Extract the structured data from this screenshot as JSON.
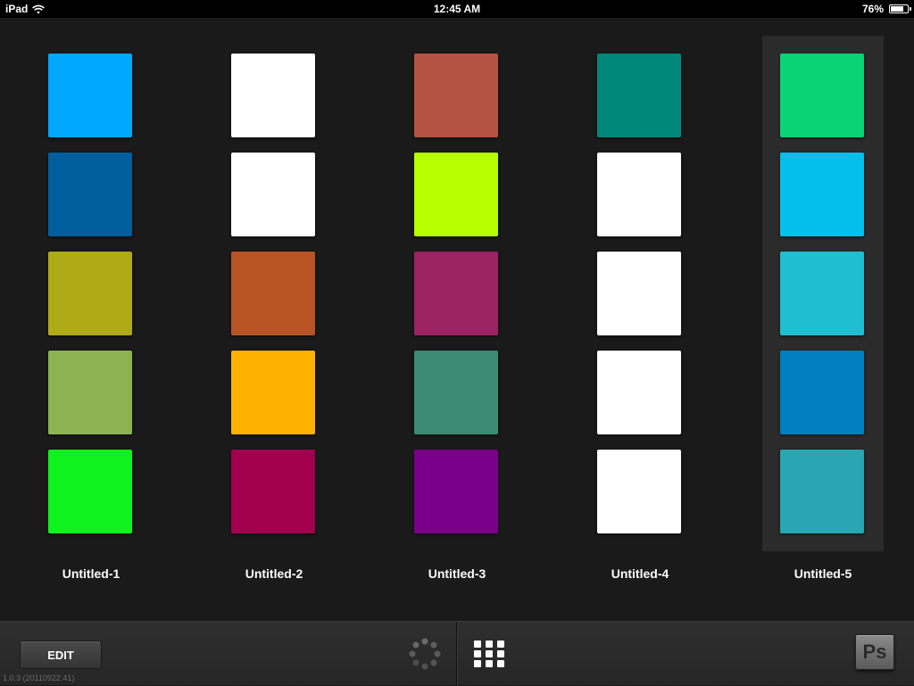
{
  "status_bar": {
    "device": "iPad",
    "time": "12:45 AM",
    "battery": "76%",
    "battery_level": 0.76
  },
  "documents": [
    {
      "label": "Untitled-1",
      "selected": false,
      "swatches": [
        "#00a8ff",
        "#005f9c",
        "#afaa18",
        "#8db353",
        "#0ff21e"
      ]
    },
    {
      "label": "Untitled-2",
      "selected": false,
      "swatches": [
        "#ffffff",
        "#ffffff",
        "#b85325",
        "#ffb100",
        "#a2004f"
      ]
    },
    {
      "label": "Untitled-3",
      "selected": false,
      "swatches": [
        "#b55244",
        "#b4ff00",
        "#9b2263",
        "#3c8c74",
        "#7a008a"
      ]
    },
    {
      "label": "Untitled-4",
      "selected": false,
      "swatches": [
        "#01877a",
        "#ffffff",
        "#ffffff",
        "#ffffff",
        "#ffffff"
      ]
    },
    {
      "label": "Untitled-5",
      "selected": true,
      "swatches": [
        "#0bd274",
        "#04bfe9",
        "#1fbed1",
        "#007fc1",
        "#28a6b2"
      ]
    }
  ],
  "toolbar": {
    "edit_label": "EDIT",
    "version": "1.0.3 (20110922.41)",
    "ps_label": "Ps"
  },
  "icons": {
    "wifi": "wifi-icon",
    "battery": "battery-icon",
    "spinner": "activity-spinner-icon",
    "grid": "grid-view-icon",
    "app": "photoshop-logo-icon"
  }
}
